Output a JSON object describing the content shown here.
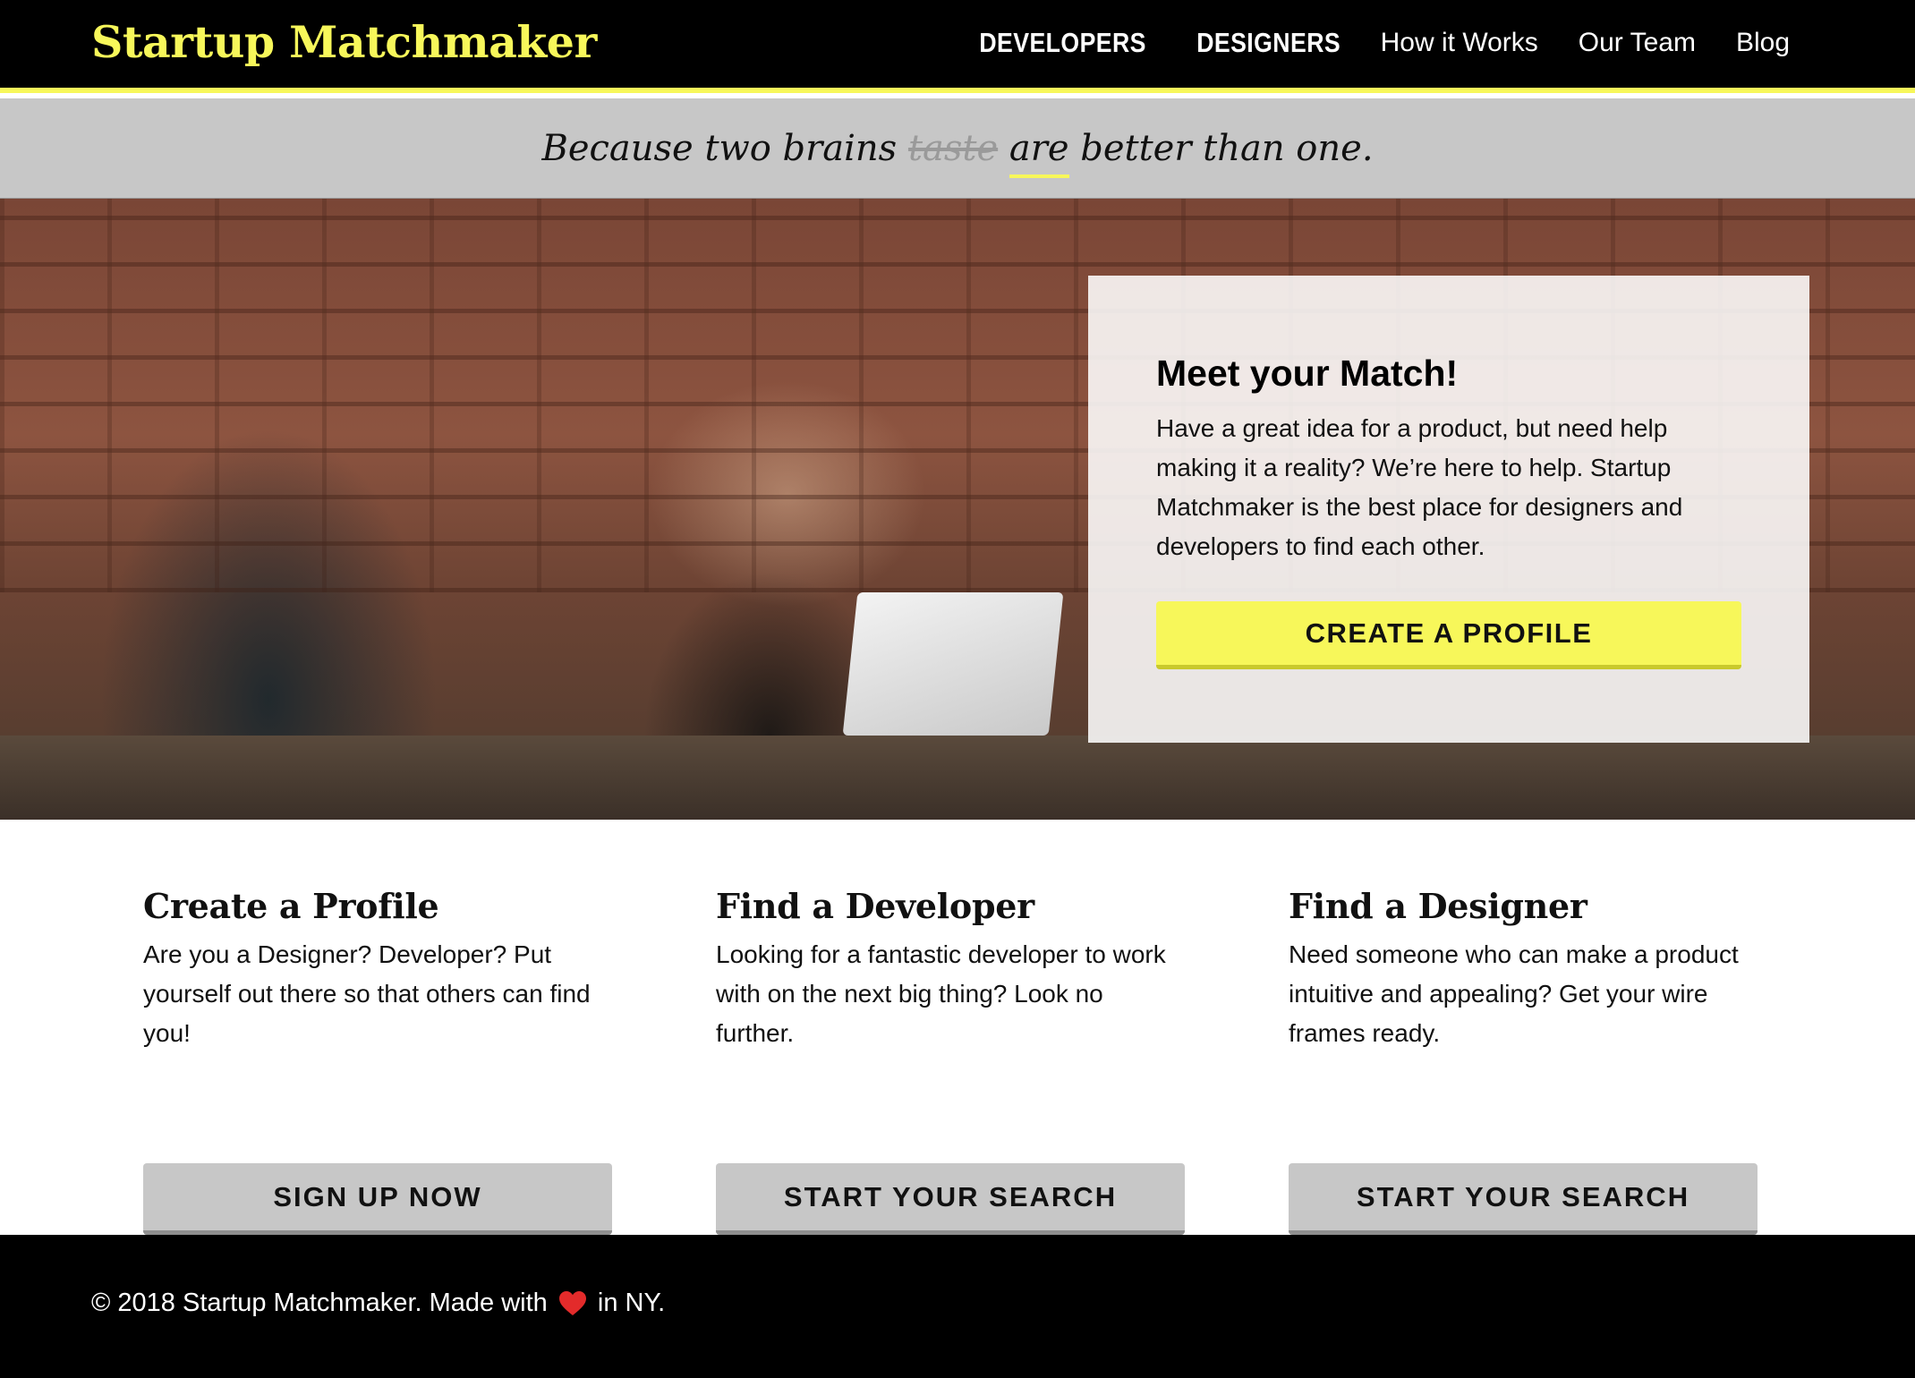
{
  "header": {
    "logo": "Startup Matchmaker",
    "nav": [
      {
        "label": "DEVELOPERS"
      },
      {
        "label": "DESIGNERS"
      },
      {
        "label": "How it Works"
      },
      {
        "label": "Our Team"
      },
      {
        "label": "Blog"
      }
    ]
  },
  "tagline": {
    "before": "Because two brains ",
    "struck": "taste",
    "emphasis": "are",
    "after": " better than one."
  },
  "hero": {
    "title": "Meet your Match!",
    "text": "Have a great idea for a product, but need help making it a reality? We’re here to help. Startup Matchmaker is the best place for designers and developers to find each other.",
    "button": "CREATE A PROFILE"
  },
  "features": [
    {
      "title": "Create a Profile",
      "text": "Are you a Designer? Developer? Put yourself out there so that others can find you!",
      "button": "SIGN UP NOW"
    },
    {
      "title": "Find a Developer",
      "text": "Looking for a fantastic developer to work with on the next big thing? Look no further.",
      "button": "START YOUR SEARCH"
    },
    {
      "title": "Find a Designer",
      "text": "Need someone who can make a product intuitive and appealing? Get your wire frames ready.",
      "button": "START YOUR SEARCH"
    }
  ],
  "footer": {
    "before": "© 2018 Startup Matchmaker. Made with ",
    "icon": "heart-icon",
    "after": " in NY."
  },
  "colors": {
    "accent": "#f7f75a",
    "header_bg": "#000000",
    "tagline_bg": "#c7c7c7",
    "button_gray": "#c7c7c7",
    "heart": "#e32b2b"
  }
}
